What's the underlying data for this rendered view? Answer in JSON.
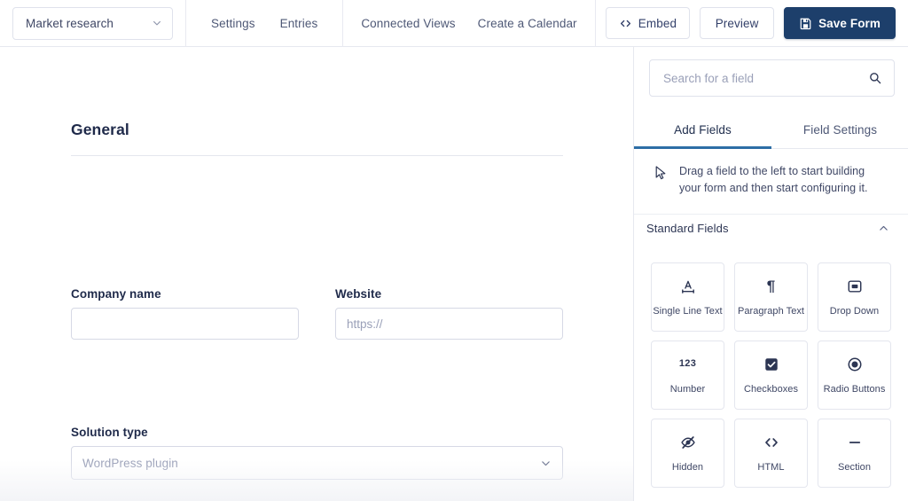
{
  "topbar": {
    "form_select": {
      "value": "Market research",
      "icon": "chevron-down-icon"
    },
    "nav_primary": [
      {
        "label": "Settings"
      },
      {
        "label": "Entries"
      }
    ],
    "nav_secondary": [
      {
        "label": "Connected Views"
      },
      {
        "label": "Create a Calendar"
      }
    ],
    "embed_button": {
      "label": "Embed",
      "icon": "code-brackets-icon"
    },
    "preview_button": {
      "label": "Preview"
    },
    "save_button": {
      "label": "Save Form",
      "icon": "save-floppy-icon"
    },
    "save_button_color": "#1d3f6b"
  },
  "canvas": {
    "section_title": "General",
    "fields": {
      "company": {
        "label": "Company name",
        "value": "",
        "placeholder": ""
      },
      "website": {
        "label": "Website",
        "value": "",
        "placeholder": "https://"
      },
      "solution": {
        "label": "Solution type",
        "value": "WordPress plugin",
        "icon": "chevron-down-icon"
      }
    }
  },
  "panel": {
    "search": {
      "placeholder": "Search for a field",
      "value": "",
      "icon": "search-icon"
    },
    "tabs": [
      {
        "label": "Add Fields",
        "active": true
      },
      {
        "label": "Field Settings",
        "active": false
      }
    ],
    "active_tab_color": "#2d6ea6",
    "hint": {
      "icon": "cursor-pointer-icon",
      "text": "Drag a field to the left to start building your form and then start configuring it."
    },
    "group": {
      "title": "Standard Fields",
      "collapse_icon": "chevron-up-icon"
    },
    "field_cards": [
      {
        "label": "Single Line Text",
        "icon": "text-width-a-icon",
        "glyph": "svg"
      },
      {
        "label": "Paragraph Text",
        "icon": "pilcrow-icon",
        "glyph": "¶"
      },
      {
        "label": "Drop Down",
        "icon": "dropdown-box-icon",
        "glyph": "svg"
      },
      {
        "label": "Number",
        "icon": "number-123-icon",
        "glyph": "123"
      },
      {
        "label": "Checkboxes",
        "icon": "checkbox-checked-icon",
        "glyph": "svg"
      },
      {
        "label": "Radio Buttons",
        "icon": "radio-selected-icon",
        "glyph": "svg"
      },
      {
        "label": "Hidden",
        "icon": "eye-off-icon",
        "glyph": "svg"
      },
      {
        "label": "HTML",
        "icon": "code-brackets-icon",
        "glyph": "svg"
      },
      {
        "label": "Section",
        "icon": "minus-dash-icon",
        "glyph": "svg"
      }
    ]
  }
}
